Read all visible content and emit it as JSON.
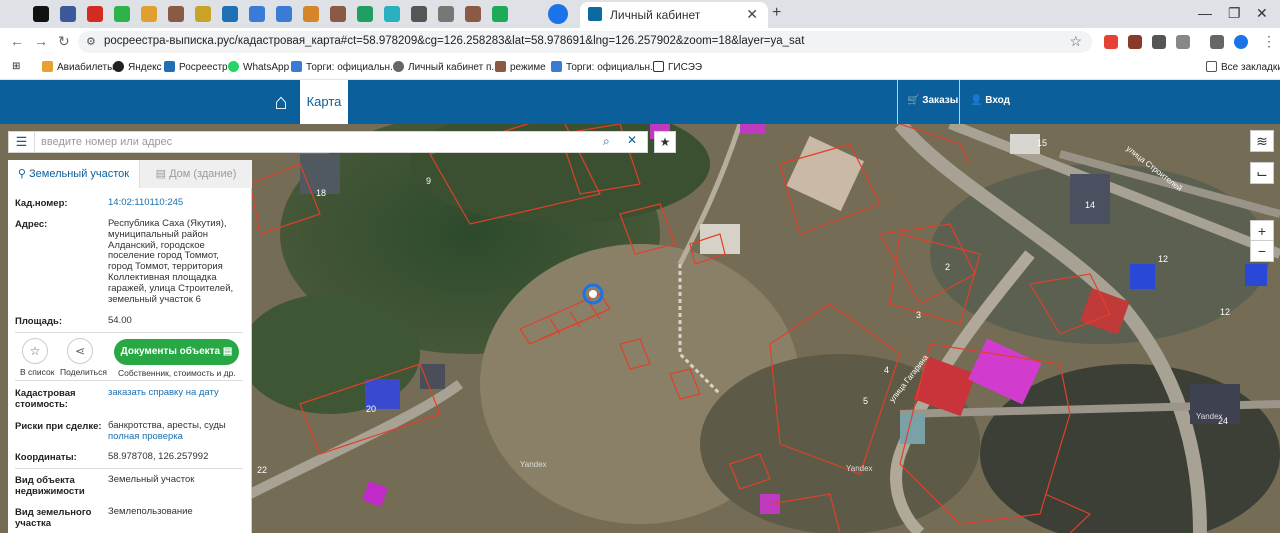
{
  "browser": {
    "tabs": [
      {
        "icon": "chevron-down-icon",
        "color": "#dee1e6"
      },
      {
        "icon": "site-icon",
        "color": "#111111"
      },
      {
        "icon": "site-icon",
        "color": "#3b5998"
      },
      {
        "icon": "flag-icon",
        "color": "#d52b1e"
      },
      {
        "icon": "mail-icon",
        "color": "#2eb34a"
      },
      {
        "icon": "site-icon",
        "color": "#e0a030"
      },
      {
        "icon": "site-icon",
        "color": "#8a5a44"
      },
      {
        "icon": "shield-icon",
        "color": "#c9a227"
      },
      {
        "icon": "site-icon",
        "color": "#1f6fb5"
      },
      {
        "icon": "site-icon",
        "color": "#3a7bd5"
      },
      {
        "icon": "site-icon",
        "color": "#3a7bd5"
      },
      {
        "icon": "shield-icon",
        "color": "#d6862a"
      },
      {
        "icon": "site-icon",
        "color": "#8a5a44"
      },
      {
        "icon": "site-icon",
        "color": "#20a060"
      },
      {
        "icon": "site-icon",
        "color": "#2ab0c0"
      },
      {
        "icon": "speaker-icon",
        "color": "#555555"
      },
      {
        "icon": "site-icon",
        "color": "#777777"
      },
      {
        "icon": "site-icon",
        "color": "#8a5a44"
      },
      {
        "icon": "check-icon",
        "color": "#1faa59"
      }
    ],
    "active_tab_title": "Личный кабинет",
    "url": "росреестра-выписка.рус/кадастровая_карта#ct=58.978209&cg=126.258283&lat=58.978691&lng=126.257902&zoom=18&layer=ya_sat",
    "bookmarks": [
      "Авиабилеты",
      "Яндекс",
      "Росреестр",
      "WhatsApp",
      "Торги: официальн...",
      "Личный кабинет п...",
      "режиме",
      "Торги: официальн...",
      "ГИСЭЭ"
    ],
    "all_bookmarks": "Все закладки"
  },
  "header": {
    "map_tab": "Карта",
    "orders": "Заказы",
    "login": "Вход"
  },
  "search": {
    "placeholder": "введите номер или адрес"
  },
  "panel": {
    "tab_land": "Земельный участок",
    "tab_house": "Дом (здание)",
    "cad_label": "Кад.номер:",
    "cad_value": "14:02:110110:245",
    "address_label": "Адрес:",
    "address_value": "Республика Саха (Якутия), муниципальный район Алданский, городское поселение город Томмот, город Томмот, территория Коллективная площадка гаражей, улица Строителей, земельный участок 6",
    "area_label": "Площадь:",
    "area_value": "54.00",
    "to_list": "В список",
    "share": "Поделиться",
    "docs_button": "Документы объекта",
    "docs_sub": "Собственник, стоимость и др.",
    "cad_cost_label": "Кадастровая стоимость:",
    "cad_cost_value": "заказать справку на дату",
    "risks_label": "Риски при сделке:",
    "risks_value": "банкротства, аресты, суды",
    "risks_link": "полная проверка",
    "coords_label": "Координаты:",
    "coords_value": "58.978708, 126.257992",
    "property_type_label": "Вид объекта недвижимости",
    "property_type_value": "Земельный участок",
    "land_type_label": "Вид земельного участка",
    "land_type_value": "Землепользование"
  },
  "map_labels": [
    "18",
    "9",
    "14",
    "15",
    "12",
    "12",
    "2",
    "3",
    "4",
    "5",
    "20",
    "22",
    "24",
    "Yandex",
    "Yandex",
    "Yandex"
  ],
  "streets": [
    "улица Строителей",
    "улица Гагарина"
  ]
}
